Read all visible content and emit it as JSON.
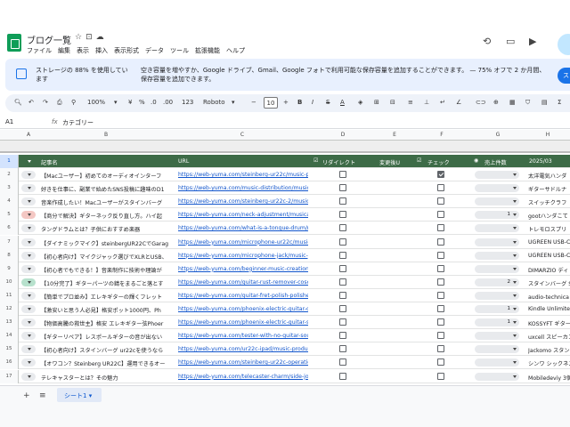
{
  "app": {
    "title": "ブログ一覧"
  },
  "menu": [
    "ファイル",
    "編集",
    "表示",
    "挿入",
    "表示形式",
    "データ",
    "ツール",
    "拡張機能",
    "ヘルプ"
  ],
  "banner": {
    "left": "ストレージの 88% を使用しています",
    "right": "空き容量を増やすか、Google ドライブ、Gmail、Google フォトで利用可能な保存容量を追加することができます。 — 75% オフで 2 か月間、保存容量を追加できます。",
    "button": "ス"
  },
  "toolbar": {
    "zoom": "100%",
    "currency": "¥",
    "percent": "%",
    "dec1": ".0",
    "dec2": ".00",
    "num": "123",
    "font": "Roboto",
    "size": "10",
    "bold": "B",
    "italic": "I",
    "strike": "S",
    "textcolor": "A"
  },
  "formula": {
    "cell": "A1",
    "content": "カテゴリー"
  },
  "columns": [
    "A",
    "B",
    "C",
    "D",
    "E",
    "F",
    "G",
    "H"
  ],
  "header_row": {
    "rownum": "1",
    "b": "記事名",
    "c": "URL",
    "d": "リダイレクト",
    "e": "変更後U",
    "f": "チェック",
    "g": "売上件数",
    "h": "2025/03"
  },
  "rows": [
    {
      "n": "2",
      "dd": "grey",
      "b": "【Macユーザー】初めてのオーディオインターフ",
      "c": "https://web-yuma.com/steinberg-ur22c/music-pr",
      "f": true,
      "g": "",
      "h": "太洋電気ハンダ"
    },
    {
      "n": "3",
      "dd": "grey",
      "b": "好きを仕事に、副業で始めたSNS投稿に趣味のD1",
      "c": "https://web-yuma.com/music-distribution/music-",
      "f": false,
      "g": "",
      "h": "ギターサドルナ"
    },
    {
      "n": "4",
      "dd": "grey",
      "b": "音楽作成したい！Macユーザーがスタインバーグ",
      "c": "https://web-yuma.com/steinberg-ur22c-2/music-",
      "f": false,
      "g": "",
      "h": "スイッチクラフ"
    },
    {
      "n": "5",
      "dd": "red",
      "b": "【商分で解決】ギターネック反り直し方。ハイ起",
      "c": "https://web-yuma.com/neck-adjustment/musical",
      "f": false,
      "g": "1",
      "h": "gootハンダこて"
    },
    {
      "n": "6",
      "dd": "grey",
      "b": "タングドラムとは？子供におすすめ楽器",
      "c": "https://web-yuma.com/what-is-a-tongue-drum/mu",
      "f": false,
      "g": "",
      "h": "トレモロスプリ"
    },
    {
      "n": "7",
      "dd": "grey",
      "b": "【ダイナミックマイク】steinbergUR22CでGarag",
      "c": "https://web-yuma.com/microphone-ur22c/music-",
      "f": false,
      "g": "",
      "h": "UGREEN USB-C"
    },
    {
      "n": "8",
      "dd": "grey",
      "b": "【初心者向け】マイクジャック選びでXLRとUSB、",
      "c": "https://web-yuma.com/microphone-jack/music-pr",
      "f": false,
      "g": "",
      "h": "UGREEN USB-C"
    },
    {
      "n": "9",
      "dd": "grey",
      "b": "【初心者でもできる！】音楽制作に技術や理論が",
      "c": "https://web-yuma.com/beginner-music-creation/m",
      "f": false,
      "g": "",
      "h": "DIMARZIO ディ"
    },
    {
      "n": "10",
      "dd": "green",
      "b": "【10分完了】ギターパーツの錆をまるごと落とす",
      "c": "https://web-yuma.com/guitar-rust-remover-cosch",
      "f": false,
      "g": "2",
      "h": "スタインバーグ Ste"
    },
    {
      "n": "11",
      "dd": "grey",
      "b": "【簡単でプロ並み】エレキギターの輝くフレット",
      "c": "https://web-yuma.com/guitar-fret-polish-polisher",
      "f": false,
      "g": "",
      "h": "audio-technica プロ"
    },
    {
      "n": "12",
      "dd": "grey",
      "b": "【激安いと思う人必見】格安ポット1000円、Ph",
      "c": "https://web-yuma.com/phoenix-electric-guitar-cho",
      "f": false,
      "g": "1",
      "h": "Kindle Unlimited"
    },
    {
      "n": "13",
      "dd": "grey",
      "b": "【物価高騰の救世主】格安 エレキギター弦Phoer",
      "c": "https://web-yuma.com/phoenix-electric-guitar-str",
      "f": false,
      "g": "1",
      "h": "KOSSYFT ギター用"
    },
    {
      "n": "14",
      "dd": "grey",
      "b": "【ギターリペア】レスポールギターの音が出ない",
      "c": "https://web-yuma.com/tester-with-no-guitar-soun",
      "f": false,
      "g": "",
      "h": "uxcell スピーカコン"
    },
    {
      "n": "15",
      "dd": "grey",
      "b": "【初心者向け】スタインバーグ ur22cを使うなら",
      "c": "https://web-yuma.com/ur22c-ipad/music-product",
      "f": false,
      "g": "",
      "h": "Jackomo スタンダー"
    },
    {
      "n": "16",
      "dd": "grey",
      "b": "【オワコン？Steinberg UR22C】運用できるオー",
      "c": "https://web-yuma.com/steinberg-ur22c-operation",
      "f": false,
      "g": "",
      "h": "シンワ シックネスゲ"
    },
    {
      "n": "17",
      "dd": "grey",
      "b": "テレキャスターとは？その魅力",
      "c": "https://web-yuma.com/telecaster-charm/side-job",
      "f": false,
      "g": "",
      "h": "Mobiledeviy 3個 木製"
    }
  ],
  "sheet": {
    "tab": "シート1"
  }
}
